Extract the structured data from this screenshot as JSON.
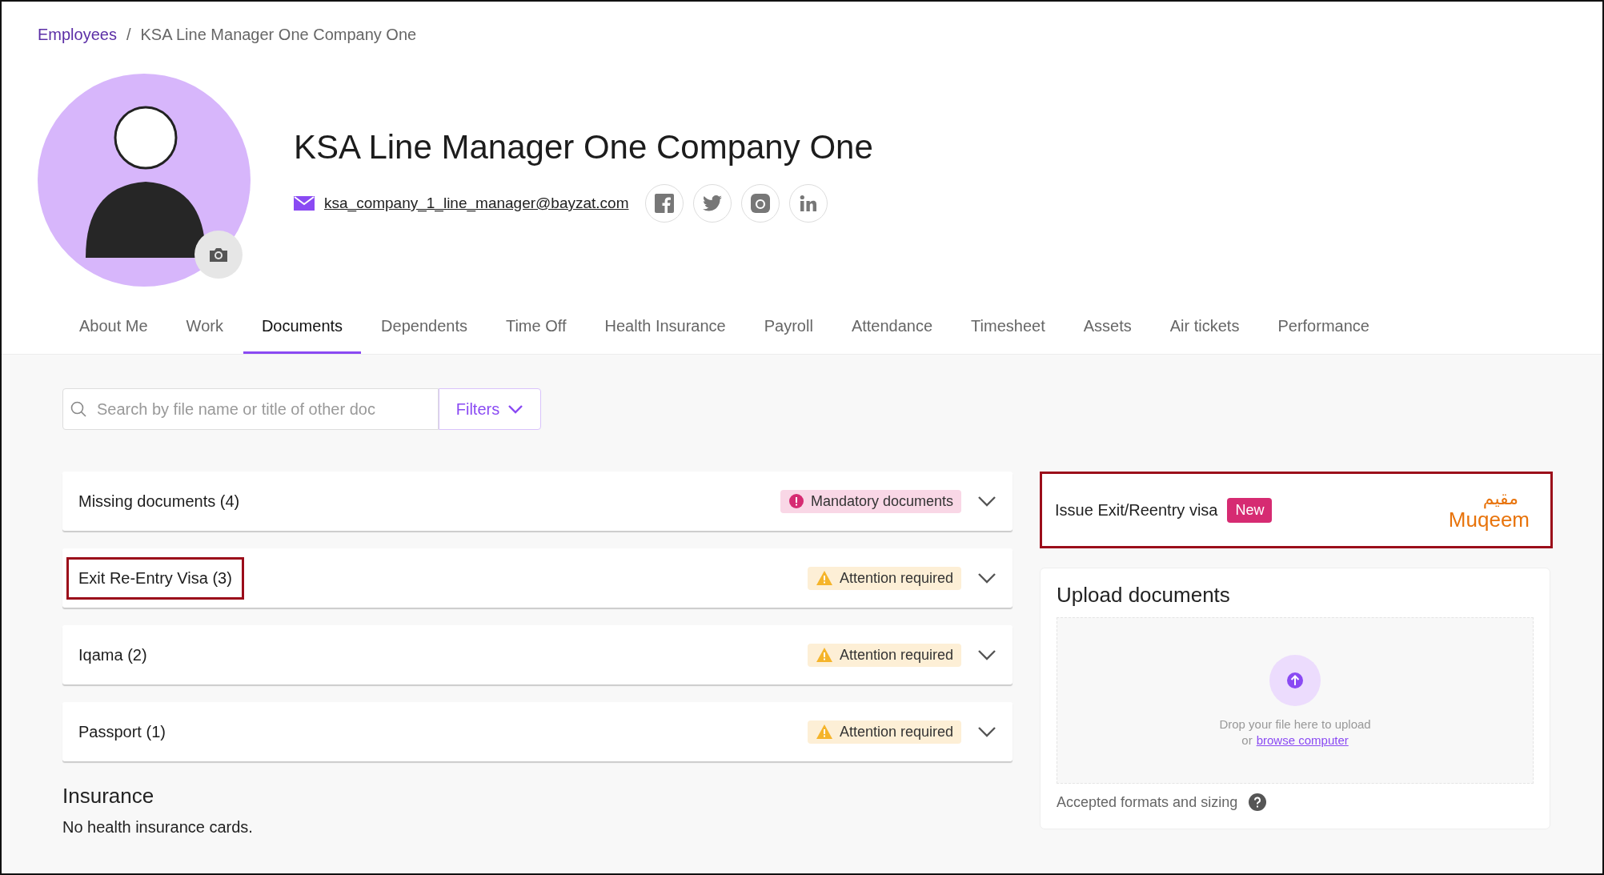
{
  "breadcrumb": [
    {
      "label": "Employees",
      "kind": "link"
    },
    {
      "label": "/",
      "kind": "separator"
    },
    {
      "label": "KSA Line Manager One Company One",
      "kind": "current"
    }
  ],
  "profile": {
    "name": "KSA Line Manager One Company One",
    "email": "ksa_company_1_line_manager@bayzat.com",
    "social": [
      {
        "kind": "facebook"
      },
      {
        "kind": "twitter"
      },
      {
        "kind": "instagram"
      },
      {
        "kind": "linkedin"
      }
    ]
  },
  "tabs": [
    {
      "label": "About Me",
      "selected": false
    },
    {
      "label": "Work",
      "selected": false
    },
    {
      "label": "Documents",
      "selected": true
    },
    {
      "label": "Dependents",
      "selected": false
    },
    {
      "label": "Time Off",
      "selected": false
    },
    {
      "label": "Health Insurance",
      "selected": false
    },
    {
      "label": "Payroll",
      "selected": false
    },
    {
      "label": "Attendance",
      "selected": false
    },
    {
      "label": "Timesheet",
      "selected": false
    },
    {
      "label": "Assets",
      "selected": false
    },
    {
      "label": "Air tickets",
      "selected": false
    },
    {
      "label": "Performance",
      "selected": false
    }
  ],
  "search": {
    "placeholder": "Search by file name or title of other doc"
  },
  "filters_button": "Filters",
  "sections": [
    {
      "title": "Missing documents (4)",
      "badge": {
        "kind": "mandatory",
        "label": "Mandatory documents"
      },
      "highlighted": false
    },
    {
      "title": "Exit Re-Entry Visa (3)",
      "badge": {
        "kind": "attention",
        "label": "Attention required"
      },
      "highlighted": true
    },
    {
      "title": "Iqama (2)",
      "badge": {
        "kind": "attention",
        "label": "Attention required"
      },
      "highlighted": false
    },
    {
      "title": "Passport (1)",
      "badge": {
        "kind": "attention",
        "label": "Attention required"
      },
      "highlighted": false
    }
  ],
  "insurance": {
    "title": "Insurance",
    "message": "No health insurance cards."
  },
  "visa_card": {
    "label": "Issue Exit/Reentry visa",
    "badge": "New",
    "logo_arabic": "مقيم",
    "logo_latin": "Muqeem",
    "highlighted": true
  },
  "upload": {
    "title": "Upload documents",
    "drop_text": "Drop your file here to upload",
    "or_text": "or",
    "browse_link": "browse computer",
    "formats_text": "Accepted formats and sizing"
  }
}
